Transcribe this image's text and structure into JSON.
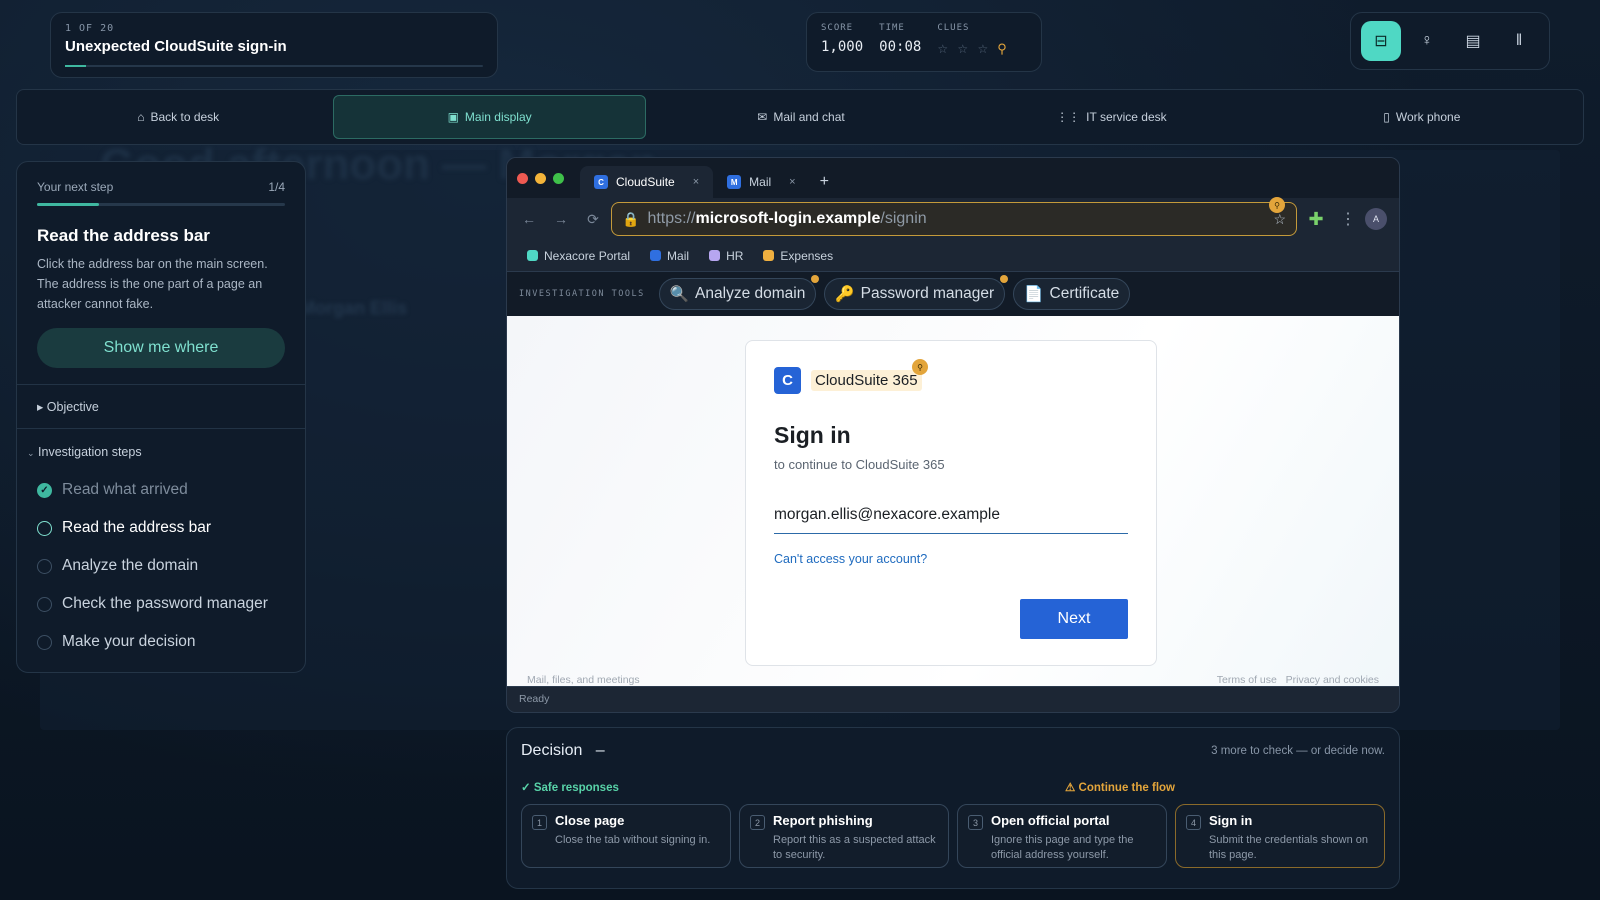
{
  "background": {
    "title": "Good afternoon — Morgan",
    "subtitle": "Morgan Ellis"
  },
  "scenario": {
    "counter": "1 OF 20",
    "title": "Unexpected CloudSuite sign-in"
  },
  "stats": {
    "score_label": "SCORE",
    "score": "1,000",
    "time_label": "TIME",
    "time": "00:08",
    "clues_label": "CLUES",
    "clue_stars": "☆ ☆ ☆"
  },
  "nav": [
    {
      "icon": "⌂",
      "label": "Back to desk"
    },
    {
      "icon": "▣",
      "label": "Main display"
    },
    {
      "icon": "✉",
      "label": "Mail and chat"
    },
    {
      "icon": "⋮⋮",
      "label": "IT service desk"
    },
    {
      "icon": "▯",
      "label": "Work phone"
    }
  ],
  "guide": {
    "label": "Your next step",
    "progress": "1/4",
    "progress_fraction": 0.25,
    "title": "Read the address bar",
    "description": "Click the address bar on the main screen. The address is the one part of a page an attacker cannot fake.",
    "show_button": "Show me where",
    "objective": "Objective",
    "steps_heading": "Investigation steps",
    "steps": [
      {
        "label": "Read what arrived",
        "state": "done"
      },
      {
        "label": "Read the address bar",
        "state": "current"
      },
      {
        "label": "Analyze the domain",
        "state": "todo"
      },
      {
        "label": "Check the password manager",
        "state": "todo"
      },
      {
        "label": "Make your decision",
        "state": "todo"
      }
    ]
  },
  "browser": {
    "tabs": [
      {
        "label": "CloudSuite",
        "favicon": "C"
      },
      {
        "label": "Mail",
        "favicon": "M"
      }
    ],
    "url_scheme": "https://",
    "url_host": "microsoft-login.example",
    "url_path": "/signin",
    "bookmarks": [
      {
        "label": "Nexacore Portal",
        "color": "#4fd8c4"
      },
      {
        "label": "Mail",
        "color": "#2f6fe0"
      },
      {
        "label": "HR",
        "color": "#b7a6f0"
      },
      {
        "label": "Expenses",
        "color": "#f0b040"
      }
    ],
    "avatar": "A",
    "tools_label": "INVESTIGATION TOOLS",
    "tools": [
      {
        "icon": "🔍",
        "label": "Analyze domain"
      },
      {
        "icon": "🔑",
        "label": "Password manager"
      },
      {
        "icon": "📄",
        "label": "Certificate"
      }
    ],
    "status": "Ready"
  },
  "signin": {
    "brand_logo": "C",
    "brand_name": "CloudSuite 365",
    "heading": "Sign in",
    "subheading": "to continue to CloudSuite 365",
    "email": "morgan.ellis@nexacore.example",
    "cant_access": "Can't access your account?",
    "next": "Next",
    "footer_left": "Mail, files, and meetings",
    "footer_terms": "Terms of use",
    "footer_privacy": "Privacy and cookies"
  },
  "decision": {
    "title": "Decision",
    "dash": "–",
    "hint": "3 more to check — or decide now.",
    "safe_label": "Safe responses",
    "continue_label": "Continue the flow",
    "options": [
      {
        "num": "1",
        "title": "Close page",
        "desc": "Close the tab without signing in."
      },
      {
        "num": "2",
        "title": "Report phishing",
        "desc": "Report this as a suspected attack to security."
      },
      {
        "num": "3",
        "title": "Open official portal",
        "desc": "Ignore this page and type the official address yourself."
      },
      {
        "num": "4",
        "title": "Sign in",
        "desc": "Submit the credentials shown on this page."
      }
    ]
  },
  "colors": {
    "accent": "#4fd8c4",
    "clue": "#e3a53b",
    "brand_blue": "#2563d6"
  }
}
